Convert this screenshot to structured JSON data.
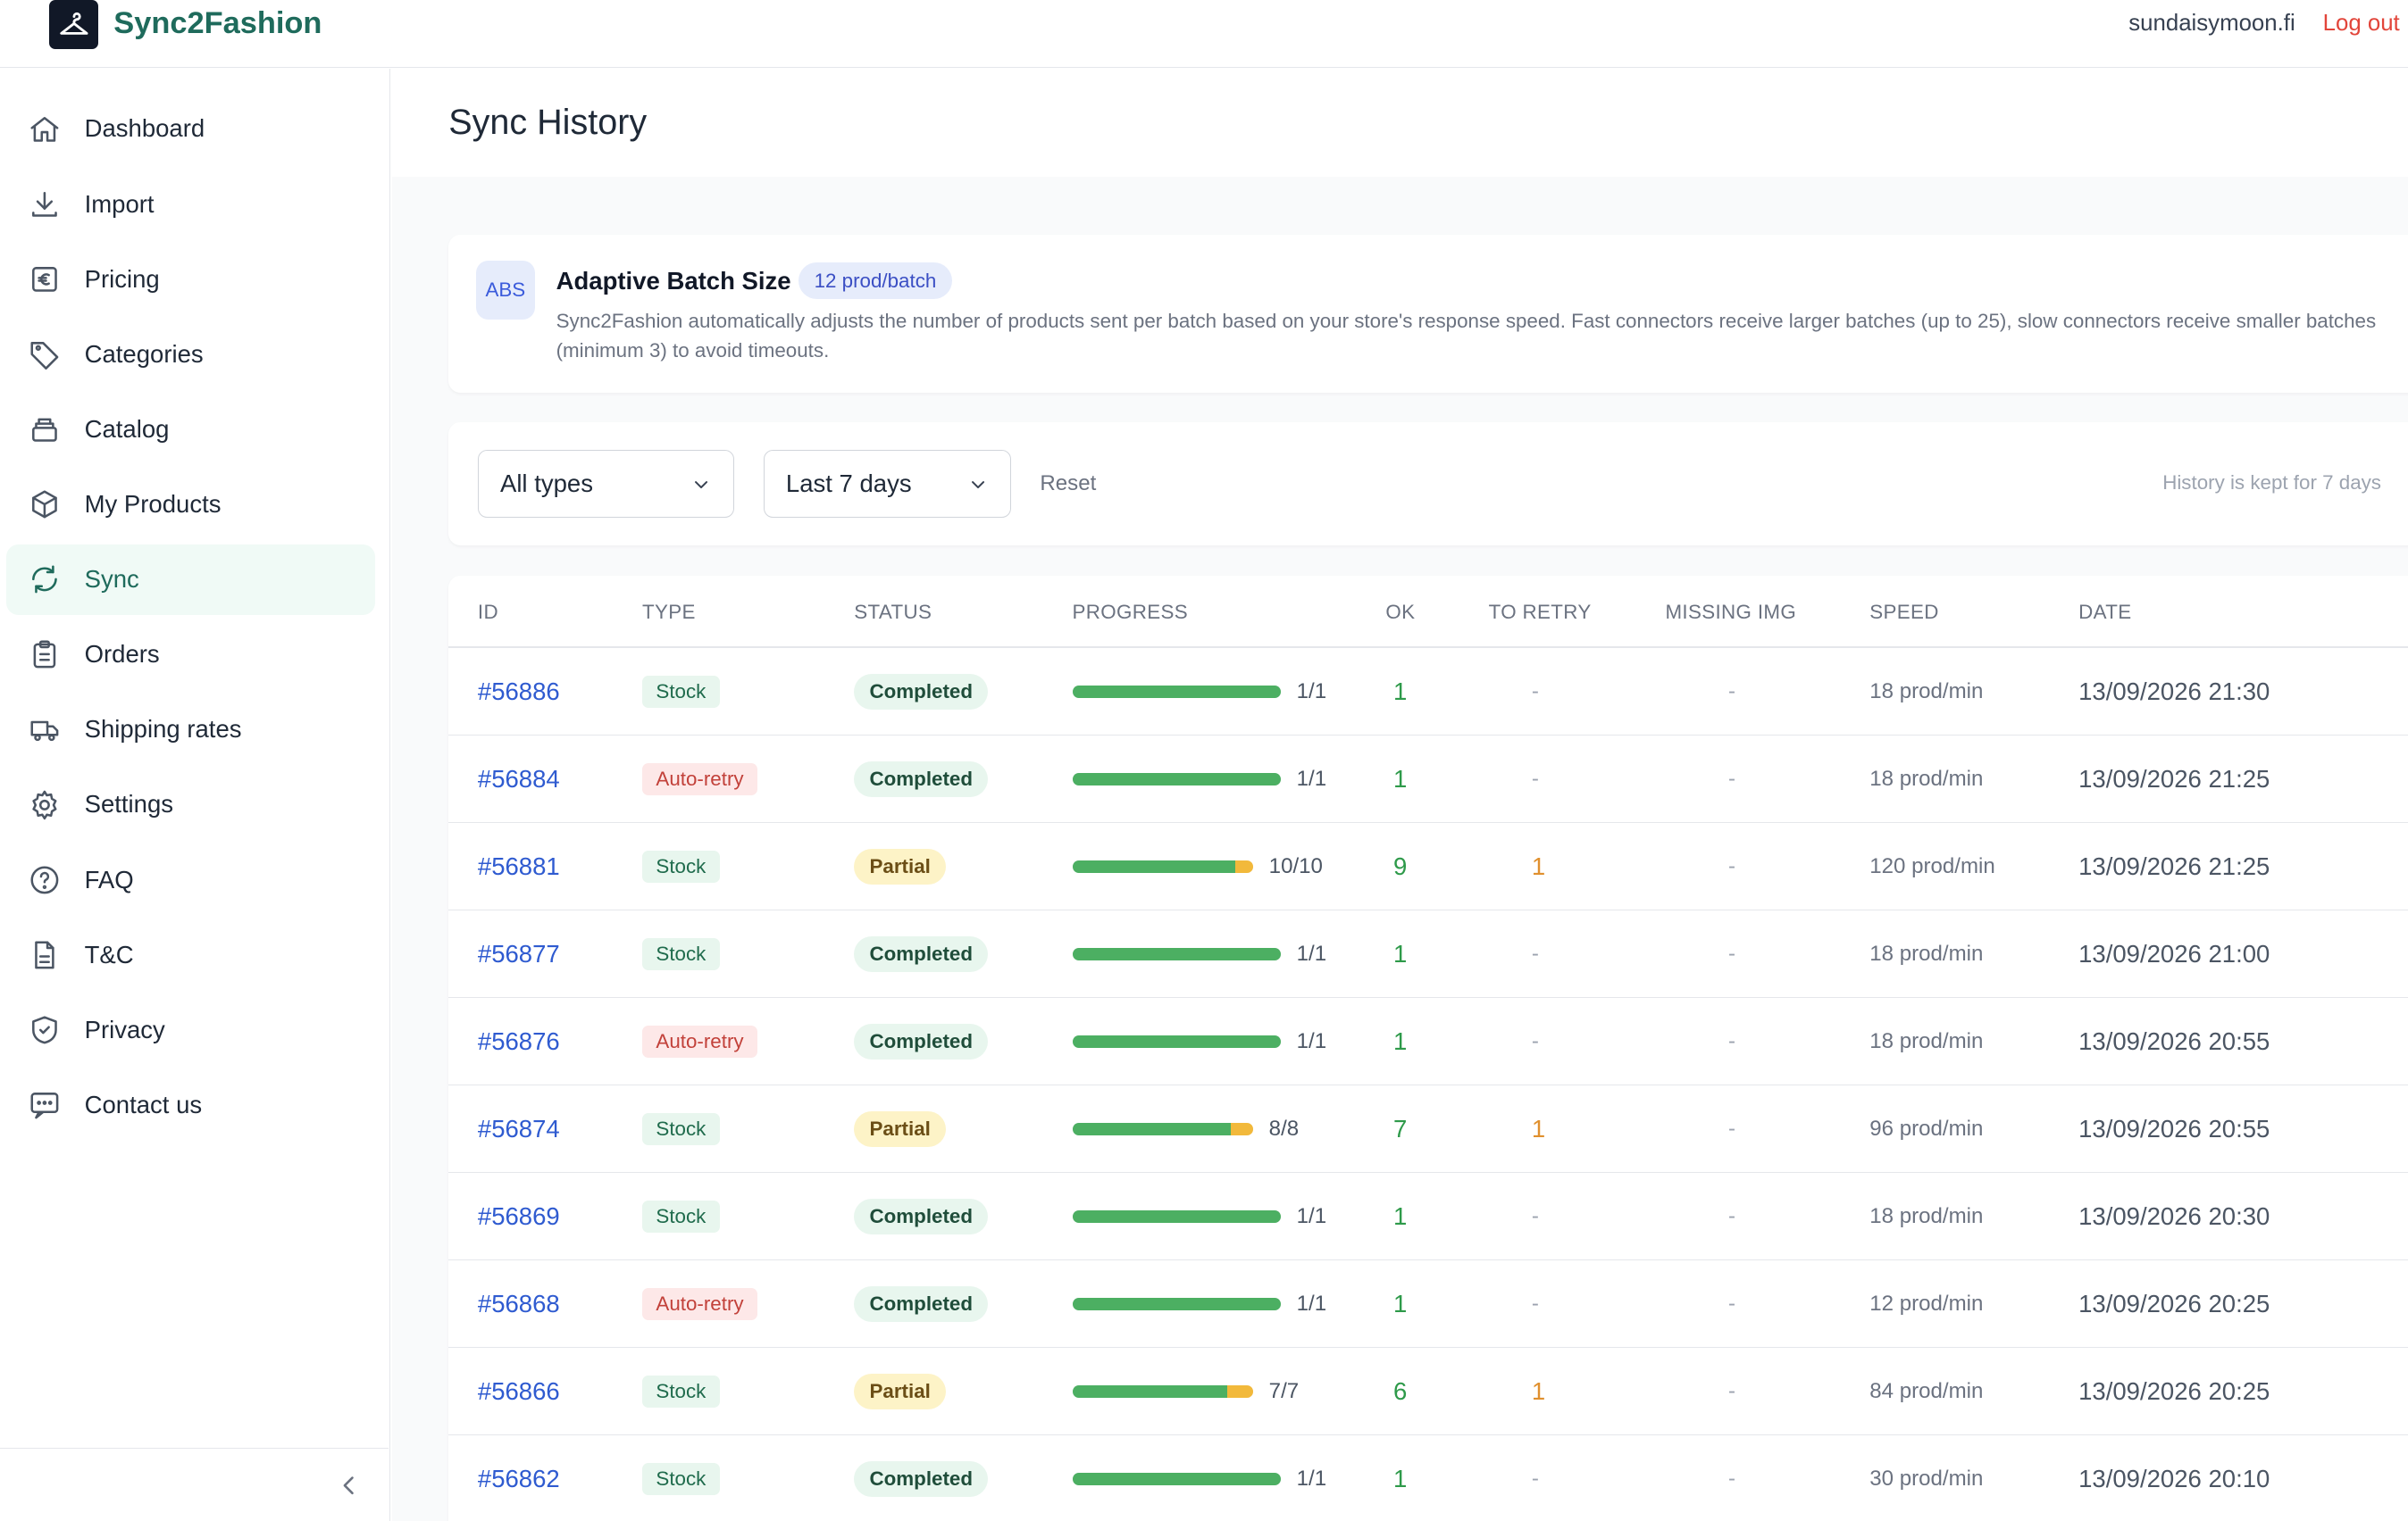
{
  "app": {
    "brand": "Sync2Fashion",
    "user": "sundaisymoon.fi",
    "logout": "Log out"
  },
  "sidebar": {
    "items": [
      {
        "label": "Dashboard",
        "icon": "home-icon"
      },
      {
        "label": "Import",
        "icon": "download-icon"
      },
      {
        "label": "Pricing",
        "icon": "euro-icon"
      },
      {
        "label": "Categories",
        "icon": "tag-icon"
      },
      {
        "label": "Catalog",
        "icon": "catalog-icon"
      },
      {
        "label": "My Products",
        "icon": "box-icon"
      },
      {
        "label": "Sync",
        "icon": "sync-icon",
        "active": true
      },
      {
        "label": "Orders",
        "icon": "clipboard-icon"
      },
      {
        "label": "Shipping rates",
        "icon": "truck-icon"
      },
      {
        "label": "Settings",
        "icon": "gear-icon"
      },
      {
        "label": "FAQ",
        "icon": "help-icon"
      },
      {
        "label": "T&C",
        "icon": "document-icon"
      },
      {
        "label": "Privacy",
        "icon": "shield-icon"
      },
      {
        "label": "Contact us",
        "icon": "chat-icon"
      }
    ]
  },
  "page": {
    "title": "Sync History"
  },
  "abs": {
    "badge": "ABS",
    "title": "Adaptive Batch Size",
    "pill": "12 prod/batch",
    "description": "Sync2Fashion automatically adjusts the number of products sent per batch based on your store's response speed. Fast connectors receive larger batches (up to 25), slow connectors receive smaller batches (minimum 3) to avoid timeouts."
  },
  "filters": {
    "type_value": "All types",
    "range_value": "Last 7 days",
    "reset": "Reset",
    "retention": "History is kept for 7 days"
  },
  "table": {
    "headers": [
      "ID",
      "TYPE",
      "STATUS",
      "PROGRESS",
      "OK",
      "TO RETRY",
      "MISSING IMG",
      "SPEED",
      "DATE"
    ],
    "rows": [
      {
        "id": "#56886",
        "type": "Stock",
        "status": "Completed",
        "ok_frac": 1.0,
        "retry_frac": 0,
        "count": "1/1",
        "ok": "1",
        "retry": "-",
        "missing": "-",
        "speed": "18 prod/min",
        "date": "13/09/2026 21:30"
      },
      {
        "id": "#56884",
        "type": "Auto-retry",
        "status": "Completed",
        "ok_frac": 1.0,
        "retry_frac": 0,
        "count": "1/1",
        "ok": "1",
        "retry": "-",
        "missing": "-",
        "speed": "18 prod/min",
        "date": "13/09/2026 21:25"
      },
      {
        "id": "#56881",
        "type": "Stock",
        "status": "Partial",
        "ok_frac": 0.9,
        "retry_frac": 0.1,
        "count": "10/10",
        "ok": "9",
        "retry": "1",
        "missing": "-",
        "speed": "120 prod/min",
        "date": "13/09/2026 21:25"
      },
      {
        "id": "#56877",
        "type": "Stock",
        "status": "Completed",
        "ok_frac": 1.0,
        "retry_frac": 0,
        "count": "1/1",
        "ok": "1",
        "retry": "-",
        "missing": "-",
        "speed": "18 prod/min",
        "date": "13/09/2026 21:00"
      },
      {
        "id": "#56876",
        "type": "Auto-retry",
        "status": "Completed",
        "ok_frac": 1.0,
        "retry_frac": 0,
        "count": "1/1",
        "ok": "1",
        "retry": "-",
        "missing": "-",
        "speed": "18 prod/min",
        "date": "13/09/2026 20:55"
      },
      {
        "id": "#56874",
        "type": "Stock",
        "status": "Partial",
        "ok_frac": 0.875,
        "retry_frac": 0.125,
        "count": "8/8",
        "ok": "7",
        "retry": "1",
        "missing": "-",
        "speed": "96 prod/min",
        "date": "13/09/2026 20:55"
      },
      {
        "id": "#56869",
        "type": "Stock",
        "status": "Completed",
        "ok_frac": 1.0,
        "retry_frac": 0,
        "count": "1/1",
        "ok": "1",
        "retry": "-",
        "missing": "-",
        "speed": "18 prod/min",
        "date": "13/09/2026 20:30"
      },
      {
        "id": "#56868",
        "type": "Auto-retry",
        "status": "Completed",
        "ok_frac": 1.0,
        "retry_frac": 0,
        "count": "1/1",
        "ok": "1",
        "retry": "-",
        "missing": "-",
        "speed": "12 prod/min",
        "date": "13/09/2026 20:25"
      },
      {
        "id": "#56866",
        "type": "Stock",
        "status": "Partial",
        "ok_frac": 0.857,
        "retry_frac": 0.143,
        "count": "7/7",
        "ok": "6",
        "retry": "1",
        "missing": "-",
        "speed": "84 prod/min",
        "date": "13/09/2026 20:25"
      },
      {
        "id": "#56862",
        "type": "Stock",
        "status": "Completed",
        "ok_frac": 1.0,
        "retry_frac": 0,
        "count": "1/1",
        "ok": "1",
        "retry": "-",
        "missing": "-",
        "speed": "30 prod/min",
        "date": "13/09/2026 20:10"
      }
    ]
  },
  "colors": {
    "brand": "#1f6b5c",
    "link": "#2f5bd0",
    "ok": "#4caf62",
    "retry": "#f2b93b",
    "logout": "#e2453a"
  }
}
